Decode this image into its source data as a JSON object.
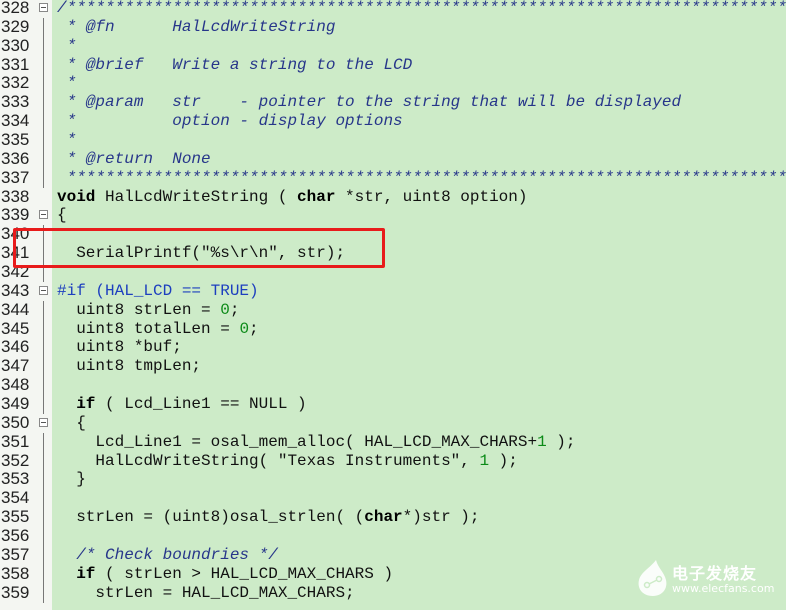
{
  "editor": {
    "colors": {
      "background": "#cdebc8",
      "comment": "#27368a",
      "number": "#0b8a17",
      "preprocessor": "#1d3fbf",
      "highlight_box": "#e81b1b"
    },
    "highlighted_lines": [
      340,
      342
    ],
    "lines": [
      {
        "n": "328",
        "fold": "box",
        "tokens": [
          {
            "c": "cm",
            "t": "/****************************************************************************"
          }
        ]
      },
      {
        "n": "329",
        "fold": "line",
        "tokens": [
          {
            "c": "cm",
            "t": " * @fn      HalLcdWriteString"
          }
        ]
      },
      {
        "n": "330",
        "fold": "line",
        "tokens": [
          {
            "c": "cm",
            "t": " *"
          }
        ]
      },
      {
        "n": "331",
        "fold": "line",
        "tokens": [
          {
            "c": "cm",
            "t": " * @brief   Write a string to the LCD"
          }
        ]
      },
      {
        "n": "332",
        "fold": "line",
        "tokens": [
          {
            "c": "cm",
            "t": " *"
          }
        ]
      },
      {
        "n": "333",
        "fold": "line",
        "tokens": [
          {
            "c": "cm",
            "t": " * @param   str    - pointer to the string that will be displayed"
          }
        ]
      },
      {
        "n": "334",
        "fold": "line",
        "tokens": [
          {
            "c": "cm",
            "t": " *          option - display options"
          }
        ]
      },
      {
        "n": "335",
        "fold": "line",
        "tokens": [
          {
            "c": "cm",
            "t": " *"
          }
        ]
      },
      {
        "n": "336",
        "fold": "line",
        "tokens": [
          {
            "c": "cm",
            "t": " * @return  None"
          }
        ]
      },
      {
        "n": "337",
        "fold": "line",
        "tokens": [
          {
            "c": "cm",
            "t": " ****************************************************************************"
          }
        ]
      },
      {
        "n": "338",
        "fold": "",
        "tokens": [
          {
            "c": "kw",
            "t": "void"
          },
          {
            "c": "tx",
            "t": " HalLcdWriteString ( "
          },
          {
            "c": "kw",
            "t": "char"
          },
          {
            "c": "tx",
            "t": " *str, uint8 option)"
          }
        ]
      },
      {
        "n": "339",
        "fold": "box",
        "tokens": [
          {
            "c": "tx",
            "t": "{"
          }
        ]
      },
      {
        "n": "340",
        "fold": "line",
        "tokens": []
      },
      {
        "n": "341",
        "fold": "line",
        "tokens": [
          {
            "c": "tx",
            "t": "  SerialPrintf(\"%s\\r\\n\", str);"
          }
        ]
      },
      {
        "n": "342",
        "fold": "line",
        "tokens": []
      },
      {
        "n": "343",
        "fold": "box",
        "tokens": [
          {
            "c": "pp",
            "t": "#if (HAL_LCD == TRUE)"
          }
        ]
      },
      {
        "n": "344",
        "fold": "line",
        "tokens": [
          {
            "c": "tx",
            "t": "  uint8 strLen = "
          },
          {
            "c": "num",
            "t": "0"
          },
          {
            "c": "tx",
            "t": ";"
          }
        ]
      },
      {
        "n": "345",
        "fold": "line",
        "tokens": [
          {
            "c": "tx",
            "t": "  uint8 totalLen = "
          },
          {
            "c": "num",
            "t": "0"
          },
          {
            "c": "tx",
            "t": ";"
          }
        ]
      },
      {
        "n": "346",
        "fold": "line",
        "tokens": [
          {
            "c": "tx",
            "t": "  uint8 *buf;"
          }
        ]
      },
      {
        "n": "347",
        "fold": "line",
        "tokens": [
          {
            "c": "tx",
            "t": "  uint8 tmpLen;"
          }
        ]
      },
      {
        "n": "348",
        "fold": "line",
        "tokens": []
      },
      {
        "n": "349",
        "fold": "line",
        "tokens": [
          {
            "c": "tx",
            "t": "  "
          },
          {
            "c": "kw",
            "t": "if"
          },
          {
            "c": "tx",
            "t": " ( Lcd_Line1 == NULL )"
          }
        ]
      },
      {
        "n": "350",
        "fold": "box",
        "tokens": [
          {
            "c": "tx",
            "t": "  {"
          }
        ]
      },
      {
        "n": "351",
        "fold": "line",
        "tokens": [
          {
            "c": "tx",
            "t": "    Lcd_Line1 = osal_mem_alloc( HAL_LCD_MAX_CHARS+"
          },
          {
            "c": "num",
            "t": "1"
          },
          {
            "c": "tx",
            "t": " );"
          }
        ]
      },
      {
        "n": "352",
        "fold": "line",
        "tokens": [
          {
            "c": "tx",
            "t": "    HalLcdWriteString( \"Texas Instruments\", "
          },
          {
            "c": "num",
            "t": "1"
          },
          {
            "c": "tx",
            "t": " );"
          }
        ]
      },
      {
        "n": "353",
        "fold": "line",
        "tokens": [
          {
            "c": "tx",
            "t": "  }"
          }
        ]
      },
      {
        "n": "354",
        "fold": "line",
        "tokens": []
      },
      {
        "n": "355",
        "fold": "line",
        "tokens": [
          {
            "c": "tx",
            "t": "  strLen = (uint8)osal_strlen( ("
          },
          {
            "c": "kw",
            "t": "char"
          },
          {
            "c": "tx",
            "t": "*)str );"
          }
        ]
      },
      {
        "n": "356",
        "fold": "line",
        "tokens": []
      },
      {
        "n": "357",
        "fold": "line",
        "tokens": [
          {
            "c": "tx",
            "t": "  "
          },
          {
            "c": "cm",
            "t": "/* Check boundries */"
          }
        ]
      },
      {
        "n": "358",
        "fold": "line",
        "tokens": [
          {
            "c": "tx",
            "t": "  "
          },
          {
            "c": "kw",
            "t": "if"
          },
          {
            "c": "tx",
            "t": " ( strLen > HAL_LCD_MAX_CHARS )"
          }
        ]
      },
      {
        "n": "359",
        "fold": "line",
        "tokens": [
          {
            "c": "tx",
            "t": "    strLen = HAL_LCD_MAX_CHARS;"
          }
        ]
      }
    ]
  },
  "watermark": {
    "brand": "电子发烧友",
    "url": "www.elecfans.com"
  }
}
